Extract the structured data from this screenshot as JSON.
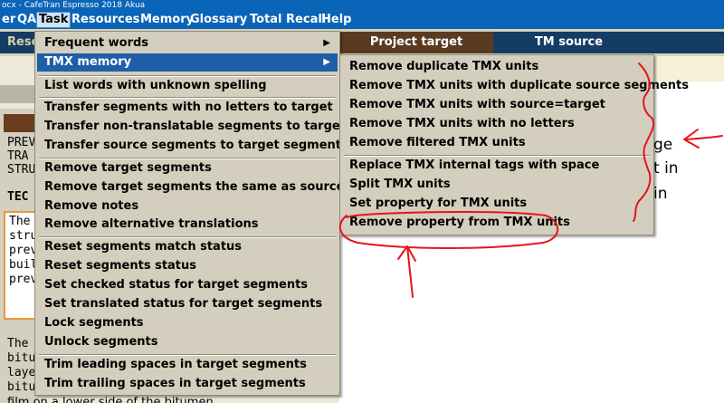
{
  "window": {
    "title": "ocx - CafeTran Espresso 2018 Akua"
  },
  "menubar": [
    "er",
    "QA",
    "Task",
    "Resources",
    "Memory",
    "Glossary",
    "Total Recall",
    "Help"
  ],
  "tabs": {
    "left": "Resc",
    "project_target": "Project target",
    "tm_source": "TM source"
  },
  "task_menu": [
    {
      "label": "Frequent words",
      "submenu": true
    },
    {
      "label": "TMX memory",
      "submenu": true,
      "selected": true
    },
    {
      "label": "List words with unknown spelling"
    },
    {
      "label": "Transfer segments with no letters to target"
    },
    {
      "label": "Transfer non-translatable segments to target"
    },
    {
      "label": "Transfer source segments to target segments"
    },
    {
      "label": "Remove target segments"
    },
    {
      "label": "Remove target segments the same as source"
    },
    {
      "label": "Remove notes"
    },
    {
      "label": "Remove alternative translations"
    },
    {
      "label": "Reset segments match status"
    },
    {
      "label": "Reset segments status"
    },
    {
      "label": "Set checked status for target segments"
    },
    {
      "label": "Set translated status for target segments"
    },
    {
      "label": "Lock segments"
    },
    {
      "label": "Unlock segments"
    },
    {
      "label": "Trim leading spaces in target segments"
    },
    {
      "label": "Trim trailing spaces in target segments"
    }
  ],
  "tmx_submenu": [
    {
      "label": "Remove duplicate TMX units"
    },
    {
      "label": "Remove TMX units with duplicate source segments"
    },
    {
      "label": "Remove TMX units with source=target"
    },
    {
      "label": "Remove TMX units with no letters"
    },
    {
      "label": "Remove filtered TMX units"
    },
    {
      "label": "Replace TMX internal tags with space"
    },
    {
      "label": "Split TMX units"
    },
    {
      "label": "Set property for TMX units"
    },
    {
      "label": "Remove property from TMX units",
      "annotated": true
    }
  ],
  "background_text": {
    "left_lines_1": [
      "PREV",
      "TRA",
      "STRU"
    ],
    "left_bold": "TEC",
    "left_lines_2": [
      "The",
      "stru",
      "prev",
      "buil",
      "prev"
    ],
    "left_lines_3": [
      "The",
      "bitu",
      "laye",
      "bitu"
    ],
    "bottom_line": "film on a lower side of the bitumen",
    "right_frags": [
      "ge",
      "t in",
      "in"
    ]
  },
  "colors": {
    "menubar": "#0a64b8",
    "selection": "#1f5ea8",
    "menu_bg": "#d3cebd",
    "annotation": "#e8131b"
  }
}
